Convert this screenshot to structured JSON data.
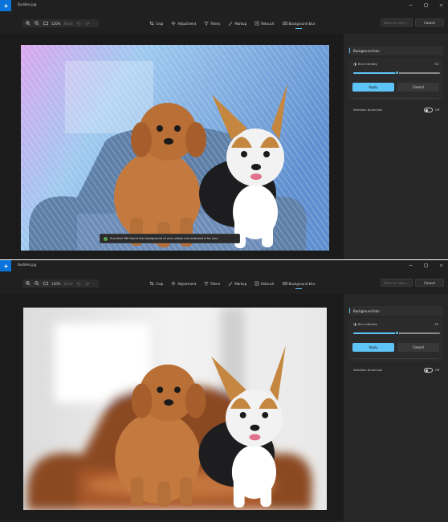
{
  "window": {
    "title": "Buddies.jpg",
    "minimize_glyph": "—",
    "maximize_glyph": "☐",
    "close_glyph": "✕"
  },
  "toolbar": {
    "zoom_in_icon": "zoom-in-icon",
    "zoom_out_icon": "zoom-out-icon",
    "fit_icon": "fit-to-window-icon",
    "zoom_level": "120%",
    "reset_label": "Reset",
    "undo_icon": "undo-icon",
    "redo_icon": "redo-icon",
    "tools": [
      {
        "label": "Crop",
        "icon": "crop-icon"
      },
      {
        "label": "Adjustment",
        "icon": "sun-icon"
      },
      {
        "label": "Filters",
        "icon": "filter-icon"
      },
      {
        "label": "Markup",
        "icon": "pen-icon"
      },
      {
        "label": "Retouch",
        "icon": "retouch-icon"
      },
      {
        "label": "Background blur",
        "icon": "background-blur-icon",
        "active": true
      }
    ],
    "save_as_copy": "Save as copy",
    "cancel": "Cancel"
  },
  "panel": {
    "header": "Background blur",
    "blur_intensity_label": "Blur intensity",
    "blur_intensity_value": "50",
    "blur_intensity_fraction": 0.5,
    "apply_label": "Apply",
    "cancel_label": "Cancel",
    "selection_brush_label": "Selection brush tool",
    "selection_brush_state": "Off"
  },
  "toast": {
    "message": "Success! We found the background of your photo and selected it for you."
  },
  "colors": {
    "accent": "#5ec4f5",
    "app_bg": "#202020",
    "panel_bg": "#272727",
    "title_icon_bg": "#0a74da"
  }
}
